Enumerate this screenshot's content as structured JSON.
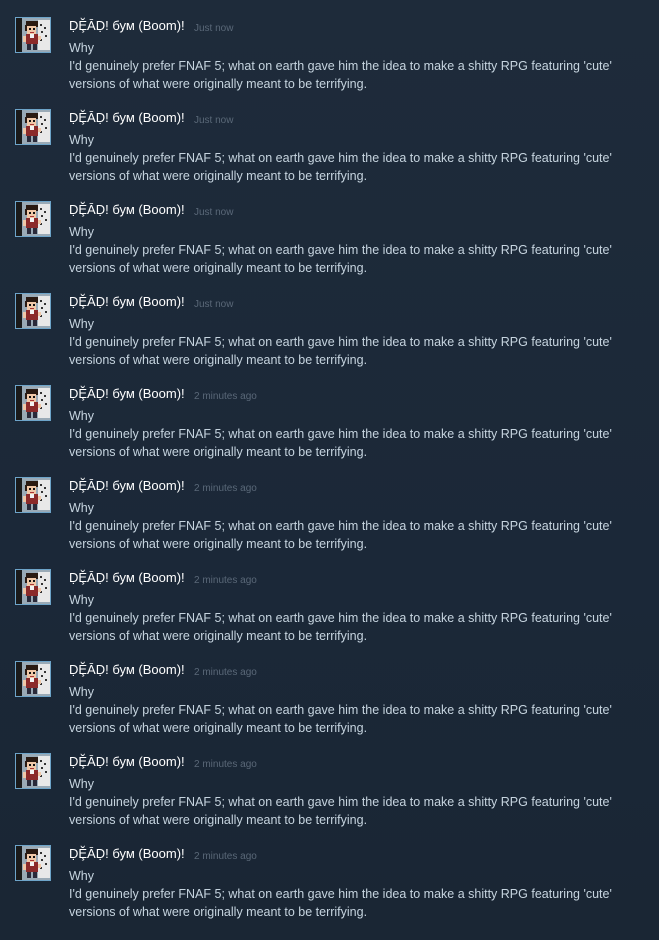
{
  "comments": [
    {
      "author": "ḌḜᾹḌ! бум (Boom)!",
      "timestamp": "Just now",
      "lines": [
        "Why",
        "I'd genuinely prefer FNAF 5; what on earth gave him the idea to make a shitty RPG featuring 'cute'",
        "versions of what were originally meant to be terrifying."
      ]
    },
    {
      "author": "ḌḜᾹḌ! бум (Boom)!",
      "timestamp": "Just now",
      "lines": [
        "Why",
        "I'd genuinely prefer FNAF 5; what on earth gave him the idea to make a shitty RPG featuring 'cute'",
        "versions of what were originally meant to be terrifying."
      ]
    },
    {
      "author": "ḌḜᾹḌ! бум (Boom)!",
      "timestamp": "Just now",
      "lines": [
        "Why",
        "I'd genuinely prefer FNAF 5; what on earth gave him the idea to make a shitty RPG featuring 'cute'",
        "versions of what were originally meant to be terrifying."
      ]
    },
    {
      "author": "ḌḜᾹḌ! бум (Boom)!",
      "timestamp": "Just now",
      "lines": [
        "Why",
        "I'd genuinely prefer FNAF 5; what on earth gave him the idea to make a shitty RPG featuring 'cute'",
        "versions of what were originally meant to be terrifying."
      ]
    },
    {
      "author": "ḌḜᾹḌ! бум (Boom)!",
      "timestamp": "2 minutes ago",
      "lines": [
        "Why",
        "I'd genuinely prefer FNAF 5; what on earth gave him the idea to make a shitty RPG featuring 'cute'",
        "versions of what were originally meant to be terrifying."
      ]
    },
    {
      "author": "ḌḜᾹḌ! бум (Boom)!",
      "timestamp": "2 minutes ago",
      "lines": [
        "Why",
        "I'd genuinely prefer FNAF 5; what on earth gave him the idea to make a shitty RPG featuring 'cute'",
        "versions of what were originally meant to be terrifying."
      ]
    },
    {
      "author": "ḌḜᾹḌ! бум (Boom)!",
      "timestamp": "2 minutes ago",
      "lines": [
        "Why",
        "I'd genuinely prefer FNAF 5; what on earth gave him the idea to make a shitty RPG featuring 'cute'",
        "versions of what were originally meant to be terrifying."
      ]
    },
    {
      "author": "ḌḜᾹḌ! бум (Boom)!",
      "timestamp": "2 minutes ago",
      "lines": [
        "Why",
        "I'd genuinely prefer FNAF 5; what on earth gave him the idea to make a shitty RPG featuring 'cute'",
        "versions of what were originally meant to be terrifying."
      ]
    },
    {
      "author": "ḌḜᾹḌ! бум (Boom)!",
      "timestamp": "2 minutes ago",
      "lines": [
        "Why",
        "I'd genuinely prefer FNAF 5; what on earth gave him the idea to make a shitty RPG featuring 'cute'",
        "versions of what were originally meant to be terrifying."
      ]
    },
    {
      "author": "ḌḜᾹḌ! бум (Boom)!",
      "timestamp": "2 minutes ago",
      "lines": [
        "Why",
        "I'd genuinely prefer FNAF 5; what on earth gave him the idea to make a shitty RPG featuring 'cute'",
        "versions of what were originally meant to be terrifying."
      ]
    }
  ],
  "colors": {
    "background": "#1b2838",
    "author": "#ffffff",
    "timestamp": "#5a6878",
    "text": "#c6d4df",
    "avatar_border": "#6da4c9"
  },
  "icons": {
    "avatar": "pixel-art-character-avatar"
  }
}
